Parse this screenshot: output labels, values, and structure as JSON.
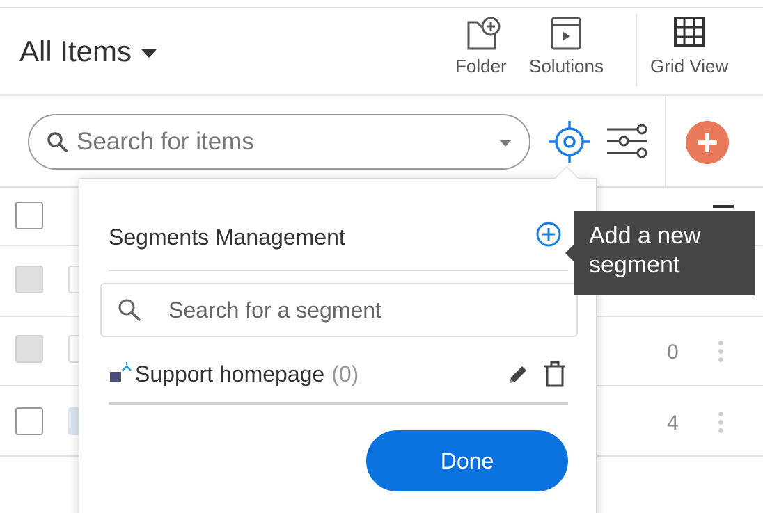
{
  "header": {
    "title": "All Items",
    "tools": [
      {
        "label": "Folder",
        "icon": "folder-add-icon"
      },
      {
        "label": "Solutions",
        "icon": "solutions-icon"
      },
      {
        "label": "Grid View",
        "icon": "grid-view-icon"
      }
    ]
  },
  "search": {
    "placeholder": "Search for items"
  },
  "table": {
    "rows": [
      {
        "count": ""
      },
      {
        "count": "0"
      },
      {
        "count": "4"
      }
    ]
  },
  "segments_popup": {
    "title": "Segments Management",
    "search_placeholder": "Search for a segment",
    "items": [
      {
        "name": "Support homepage",
        "count": "(0)"
      }
    ],
    "done_label": "Done"
  },
  "tooltip": {
    "text": "Add a new segment"
  },
  "colors": {
    "accent_blue": "#0a73e0",
    "add_button": "#e8795a",
    "tooltip_bg": "#464646"
  }
}
